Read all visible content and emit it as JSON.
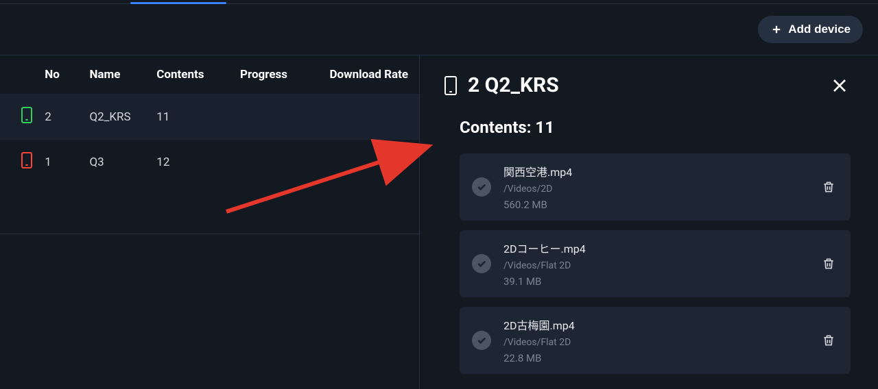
{
  "toolbar": {
    "add_device_label": "Add device"
  },
  "table": {
    "columns": {
      "no": "No",
      "name": "Name",
      "contents": "Contents",
      "progress": "Progress",
      "download_rate": "Download Rate"
    },
    "rows": [
      {
        "no": "2",
        "name": "Q2_KRS",
        "contents": "11",
        "status_color": "green",
        "selected": true
      },
      {
        "no": "1",
        "name": "Q3",
        "contents": "12",
        "status_color": "red",
        "selected": false
      }
    ]
  },
  "detail": {
    "title": "2 Q2_KRS",
    "contents_label_prefix": "Contents: ",
    "contents_count": "11",
    "files": [
      {
        "name": "関西空港.mp4",
        "path": "/Videos/2D",
        "size": "560.2 MB"
      },
      {
        "name": "2Dコーヒー.mp4",
        "path": "/Videos/Flat 2D",
        "size": "39.1 MB"
      },
      {
        "name": "2D古梅園.mp4",
        "path": "/Videos/Flat 2D",
        "size": "22.8 MB"
      }
    ]
  }
}
